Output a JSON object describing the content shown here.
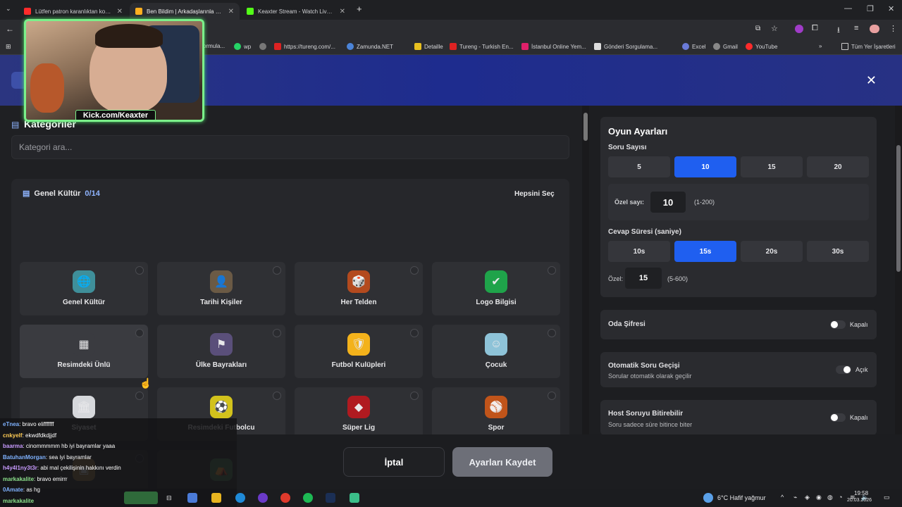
{
  "browser": {
    "tabs": [
      {
        "title": "Lütfen patron karanlıktan korkuyor",
        "active": false
      },
      {
        "title": "Ben Bildim | Arkadaşlarınla Online",
        "active": true
      },
      {
        "title": "Keaxter Stream - Watch Live on",
        "active": false
      }
    ],
    "bookmarks": [
      "ormula...",
      "wp",
      "https://tureng.com/...",
      "Zamunda.NET",
      "Detaille",
      "Tureng - Turkish En...",
      "İstanbul Online Yem...",
      "Gönderi Sorgulama...",
      "Excel",
      "Gmail",
      "YouTube",
      "Tüm Yer İşaretleri"
    ],
    "win_controls": [
      "—",
      "❐",
      "✕"
    ]
  },
  "left": {
    "title": "Kategoriler",
    "search_placeholder": "Kategori ara...",
    "group_title": "Genel Kültür",
    "group_count": "0/14",
    "select_all": "Hepsini Seç",
    "cards": [
      {
        "label": "Genel Kültür",
        "icon": "globe-icon",
        "glyph": "🌐",
        "bg": "#3f8f9a"
      },
      {
        "label": "Tarihi Kişiler",
        "icon": "portrait-icon",
        "glyph": "👤",
        "bg": "#6b5a45"
      },
      {
        "label": "Her Telden",
        "icon": "mix-icon",
        "glyph": "🎲",
        "bg": "#b34a1e"
      },
      {
        "label": "Logo Bilgisi",
        "icon": "logo-icon",
        "glyph": "✔",
        "bg": "#1fa34a"
      },
      {
        "label": "Resimdeki Ünlü",
        "icon": "building-icon",
        "glyph": "▦",
        "bg": "#3a3b40"
      },
      {
        "label": "Ülke Bayrakları",
        "icon": "flag-icon",
        "glyph": "⚑",
        "bg": "#5a4f7a"
      },
      {
        "label": "Futbol Kulüpleri",
        "icon": "club-crest-icon",
        "glyph": "🛡",
        "bg": "#f3b21b"
      },
      {
        "label": "Çocuk",
        "icon": "child-icon",
        "glyph": "☺",
        "bg": "#8ec3d8"
      },
      {
        "label": "Siyaset",
        "icon": "parliament-icon",
        "glyph": "🏛",
        "bg": "#d6d8dc"
      },
      {
        "label": "Resimdeki Futbolcu",
        "icon": "footballer-icon",
        "glyph": "⚽",
        "bg": "#d2c21c"
      },
      {
        "label": "Süper Lig",
        "icon": "league-icon",
        "glyph": "◆",
        "bg": "#b01a20"
      },
      {
        "label": "Spor",
        "icon": "sports-balls-icon",
        "glyph": "⚾",
        "bg": "#c0541a"
      },
      {
        "label": "",
        "icon": "chest-icon",
        "glyph": "▣",
        "bg": "#9a7a45"
      },
      {
        "label": "",
        "icon": "festival-icon",
        "glyph": "⛺",
        "bg": "#4a7a55"
      }
    ]
  },
  "right": {
    "settings_title": "Oyun Ayarları",
    "question_count_label": "Soru Sayısı",
    "question_options": [
      "5",
      "10",
      "15",
      "20"
    ],
    "question_selected": "10",
    "custom_count_label": "Özel sayı:",
    "custom_count_value": "10",
    "custom_count_range": "(1-200)",
    "answer_time_label": "Cevap Süresi (saniye)",
    "time_options": [
      "10s",
      "15s",
      "20s",
      "30s"
    ],
    "time_selected": "15s",
    "custom_time_label": "Özel:",
    "custom_time_value": "15",
    "custom_time_range": "(5-600)",
    "room_password": {
      "label": "Oda Şifresi",
      "state": "Kapalı"
    },
    "auto_next": {
      "label": "Otomatik Soru Geçişi",
      "desc": "Sorular otomatik olarak geçilir",
      "state": "Açık"
    },
    "host_end": {
      "label": "Host Soruyu Bitirebilir",
      "desc": "Soru sadece süre bitince biter",
      "state": "Kapalı"
    }
  },
  "footer": {
    "cancel": "İptal",
    "save": "Ayarları Kaydet"
  },
  "stream": {
    "tag": "Kick.com/Keaxter"
  },
  "chat": [
    {
      "user": "eTnea",
      "msg": ": bravo elifffffff",
      "color": "#7fb2ff"
    },
    {
      "user": "cnkyelf",
      "msg": ": ekwdfdkdjjdf",
      "color": "#ffcc55"
    },
    {
      "user": "baarma",
      "msg": ": cinommmmm hb iyi bayramlar yaaa",
      "color": "#c89bff"
    },
    {
      "user": "BatuhanMorgan",
      "msg": ": sea iyi bayramlar",
      "color": "#7fb2ff"
    },
    {
      "user": "h4y4l1ny3t3r",
      "msg": ": abi mal çekilişinin hakkını verdin",
      "color": "#c89bff"
    },
    {
      "user": "markakalite",
      "msg": ": bravo emirrr",
      "color": "#8be08b"
    },
    {
      "user": "0Amate",
      "msg": ": as hg",
      "color": "#7fb2ff"
    },
    {
      "user": "markakalite",
      "msg": "",
      "color": "#8be08b"
    }
  ],
  "taskbar": {
    "weather": "6°C  Hafif yağmur",
    "time": "19:58",
    "date": "20.03.2026"
  }
}
